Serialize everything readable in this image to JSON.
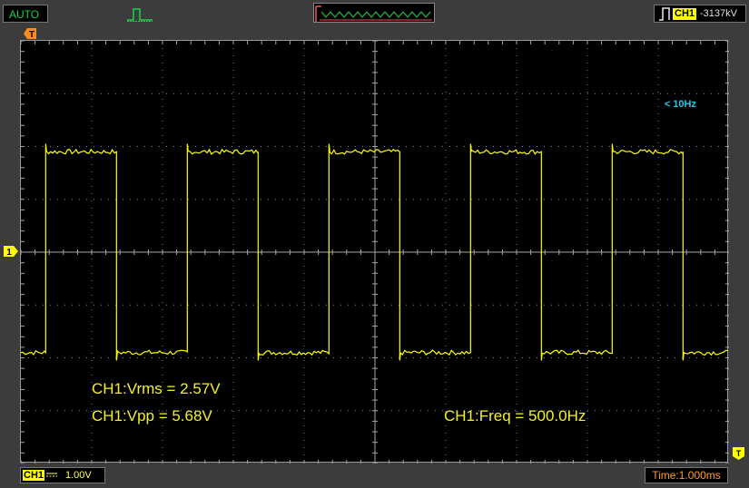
{
  "toolbar": {
    "mode": "AUTO",
    "trigger_channel": "CH1",
    "trigger_level": "-3137kV"
  },
  "display": {
    "frequency_hint": "< 10Hz",
    "trigger_marker": "T",
    "channel_marker": "1"
  },
  "measurements": {
    "vrms": "CH1:Vrms = 2.57V",
    "vpp": "CH1:Vpp = 5.68V",
    "freq": "CH1:Freq = 500.0Hz"
  },
  "status": {
    "channel": "CH1",
    "volts_per_div": "1.00V",
    "timebase": "Time:1.000ms"
  },
  "colors": {
    "trace": "#ffff00",
    "grid": "#a8a8a8",
    "mode_text": "#19d24a",
    "freq_hint": "#27c6e6",
    "timebase_text": "#ff9a2a"
  },
  "chart_data": {
    "type": "line",
    "title": "",
    "xlabel": "",
    "ylabel": "",
    "grid": true,
    "divisions": {
      "x": 10,
      "y": 8
    },
    "xlim": [
      0,
      10
    ],
    "ylim": [
      -4,
      4
    ],
    "series": [
      {
        "name": "CH1",
        "waveform": "square",
        "high_v": 1.9,
        "low_v": -1.9,
        "period_div": 2.0,
        "first_rising_div": 0.35,
        "duty": 0.5
      }
    ]
  }
}
